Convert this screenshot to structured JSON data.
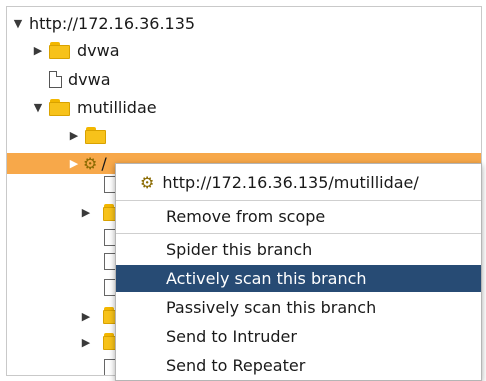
{
  "tree": {
    "root": {
      "label": "http://172.16.36.135"
    },
    "items": [
      {
        "label": "dvwa",
        "kind": "folder",
        "expanded": false
      },
      {
        "label": "dvwa",
        "kind": "file"
      },
      {
        "label": "mutillidae",
        "kind": "folder",
        "expanded": true
      },
      {
        "label": "",
        "kind": "folder",
        "expanded": false
      },
      {
        "label": "/",
        "kind": "node",
        "selected": true
      }
    ]
  },
  "context_menu": {
    "header": "http://172.16.36.135/mutillidae/",
    "items": [
      {
        "label": "Remove from scope"
      },
      {
        "label": "Spider this branch"
      },
      {
        "label": "Actively scan this branch",
        "active": true
      },
      {
        "label": "Passively scan this branch"
      },
      {
        "label": "Send to Intruder"
      },
      {
        "label": "Send to Repeater"
      }
    ]
  },
  "colors": {
    "selection": "#f7a84a",
    "menu_active": "#274b74",
    "folder": "#f7c21a"
  }
}
